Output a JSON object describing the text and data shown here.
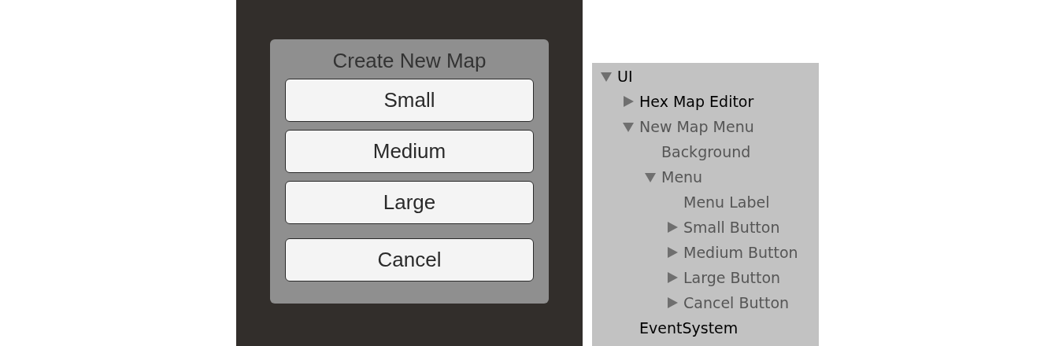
{
  "dialog": {
    "title": "Create New Map",
    "buttons": [
      "Small",
      "Medium",
      "Large"
    ],
    "cancel_button": "Cancel"
  },
  "hierarchy": {
    "items": [
      {
        "label": "UI",
        "disabled": false,
        "expanded": true,
        "children": [
          {
            "label": "Hex Map Editor",
            "disabled": false,
            "expanded": false
          },
          {
            "label": "New Map Menu",
            "disabled": true,
            "expanded": true,
            "children": [
              {
                "label": "Background",
                "disabled": true
              },
              {
                "label": "Menu",
                "disabled": true,
                "expanded": true,
                "children": [
                  {
                    "label": "Menu Label",
                    "disabled": true
                  },
                  {
                    "label": "Small Button",
                    "disabled": true,
                    "expanded": false
                  },
                  {
                    "label": "Medium Button",
                    "disabled": true,
                    "expanded": false
                  },
                  {
                    "label": "Large Button",
                    "disabled": true,
                    "expanded": false
                  },
                  {
                    "label": "Cancel Button",
                    "disabled": true,
                    "expanded": false
                  }
                ]
              }
            ]
          },
          {
            "label": "EventSystem",
            "disabled": false
          }
        ]
      }
    ]
  }
}
